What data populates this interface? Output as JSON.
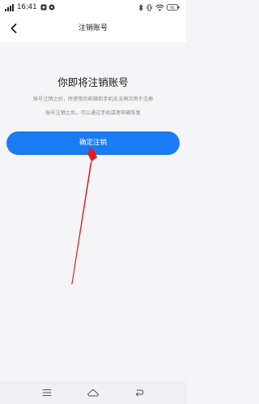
{
  "status_bar": {
    "time": "16:41",
    "battery_level": "95",
    "icons": [
      "signal-icon",
      "app-notification-icon",
      "bluetooth-icon",
      "vibrate-icon",
      "wifi-icon",
      "battery-icon"
    ]
  },
  "header": {
    "title": "注销账号",
    "back_icon": "back-arrow-icon"
  },
  "main": {
    "heading": "你即将注销账号",
    "description_lines": [
      "账号注销之后，所使用的邮箱和手机无法再次用于注册",
      "账号注销之后，可以通过手机或者邮箱恢复"
    ],
    "confirm_button": "确定注销"
  },
  "colors": {
    "accent": "#1a7bf2",
    "annotation": "#e02020",
    "background": "#f5f5f7"
  },
  "nav_bar": {
    "icons": [
      "menu-icon",
      "home-icon",
      "back-icon"
    ]
  }
}
